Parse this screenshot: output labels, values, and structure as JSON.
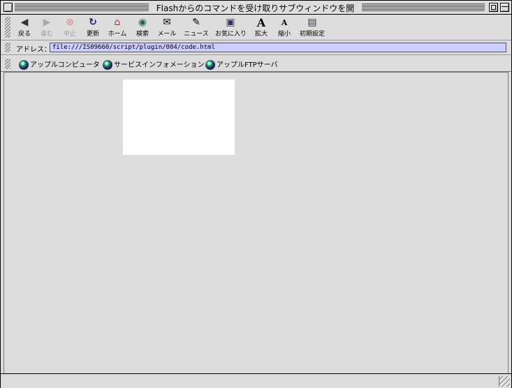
{
  "window": {
    "title": "Flashからのコマンドを受け取りサブウィンドウを開"
  },
  "toolbar": {
    "buttons": [
      {
        "label": "戻る",
        "icon": "back-arrow-icon",
        "glyph": "◆",
        "enabled": true
      },
      {
        "label": "進む",
        "icon": "forward-arrow-icon",
        "glyph": "➡",
        "enabled": false
      },
      {
        "label": "中止",
        "icon": "stop-icon",
        "glyph": "⊗",
        "enabled": false
      },
      {
        "label": "更新",
        "icon": "refresh-icon",
        "glyph": "↻",
        "enabled": true
      },
      {
        "label": "ホーム",
        "icon": "home-icon",
        "glyph": "⌂",
        "enabled": true
      },
      {
        "label": "検索",
        "icon": "search-globe-icon",
        "glyph": "◉",
        "enabled": true
      },
      {
        "label": "メール",
        "icon": "mail-icon",
        "glyph": "✉",
        "enabled": true
      },
      {
        "label": "ニュース",
        "icon": "news-icon",
        "glyph": "☁",
        "enabled": true
      },
      {
        "label": "お気に入り",
        "icon": "favorites-folder-icon",
        "glyph": "▣",
        "enabled": true
      },
      {
        "label": "拡大",
        "icon": "text-larger-icon",
        "glyph": "A",
        "enabled": true
      },
      {
        "label": "縮小",
        "icon": "text-smaller-icon",
        "glyph": "A",
        "enabled": true
      },
      {
        "label": "初期設定",
        "icon": "preferences-icon",
        "glyph": "▤",
        "enabled": true
      }
    ]
  },
  "address": {
    "label": "アドレス：",
    "value": "file:///IS09660/script/plugin/004/code.html"
  },
  "favorites": [
    {
      "label": "アップルコンピュータ",
      "icon": "globe-icon"
    },
    {
      "label": "サービスインフォメーション",
      "icon": "globe-icon"
    },
    {
      "label": "アップルFTPサーバ",
      "icon": "globe-icon"
    }
  ],
  "colors": {
    "chrome": "#dddddd",
    "address_field": "#ccccff",
    "flash_area": "#ffffff"
  }
}
